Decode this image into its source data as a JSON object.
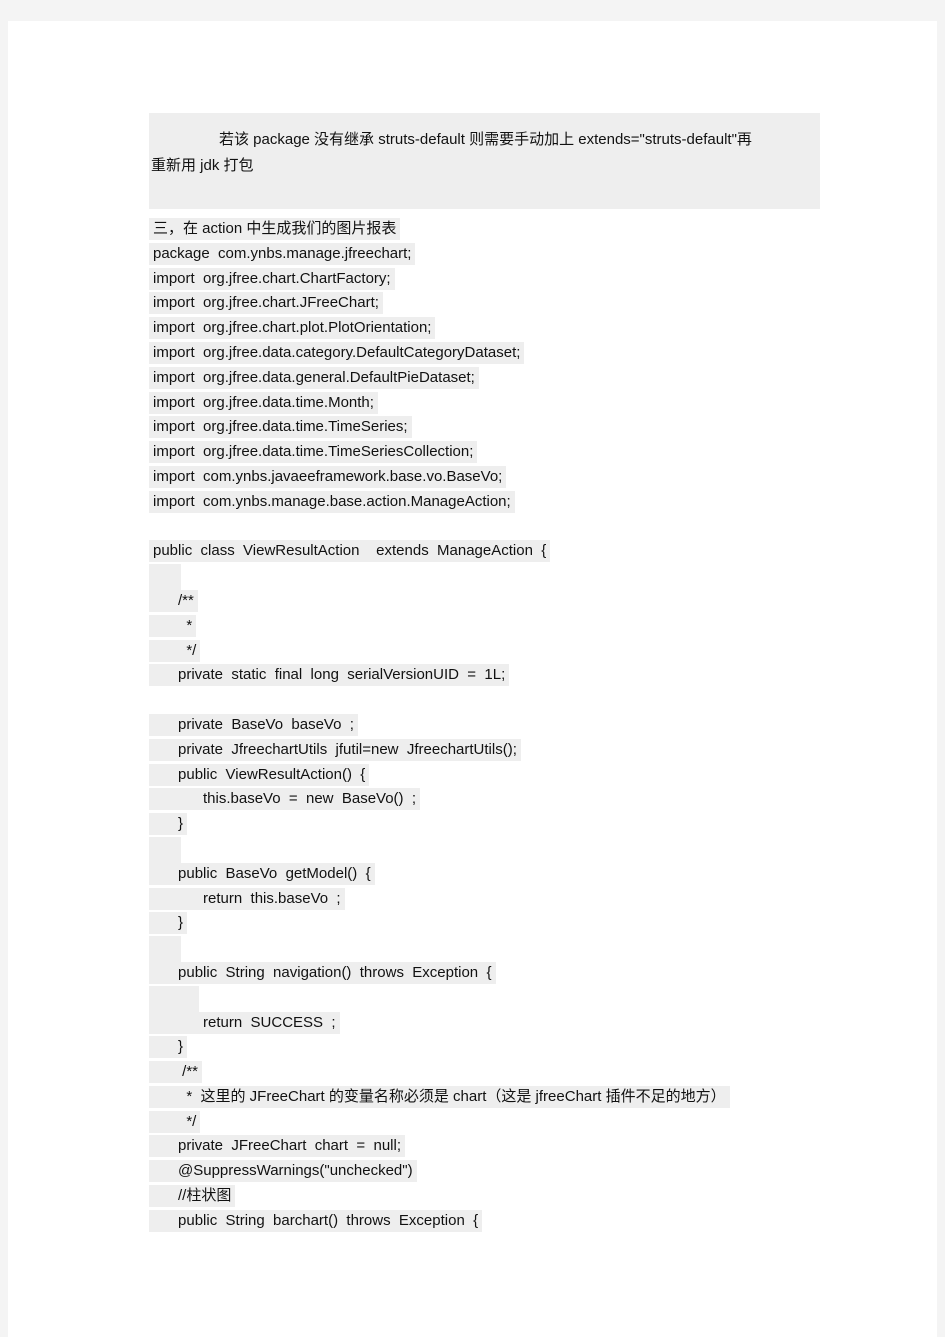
{
  "document": {
    "callout": {
      "lines": [
        "若该 package 没有继承 struts-default 则需要手动加上 extends=\"struts-default\"再",
        "重新用 jdk 打包"
      ]
    },
    "section_heading": "三，在 action 中生成我们的图片报表",
    "code_lines": [
      "package  com.ynbs.manage.jfreechart;",
      "import  org.jfree.chart.ChartFactory;",
      "import  org.jfree.chart.JFreeChart;",
      "import  org.jfree.chart.plot.PlotOrientation;",
      "import  org.jfree.data.category.DefaultCategoryDataset;",
      "import  org.jfree.data.general.DefaultPieDataset;",
      "import  org.jfree.data.time.Month;",
      "import  org.jfree.data.time.TimeSeries;",
      "import  org.jfree.data.time.TimeSeriesCollection;",
      "import  com.ynbs.javaeeframework.base.vo.BaseVo;",
      "import  com.ynbs.manage.base.action.ManageAction;",
      "",
      "public  class  ViewResultAction    extends  ManageAction  {",
      "    ",
      "      /**",
      "        *",
      "        */",
      "      private  static  final  long  serialVersionUID  =  1L;",
      "",
      "      private  BaseVo  baseVo  ;",
      "      private  JfreechartUtils  jfutil=new  JfreechartUtils();",
      "      public  ViewResultAction()  {",
      "            this.baseVo  =  new  BaseVo()  ;",
      "      }",
      "    ",
      "      public  BaseVo  getModel()  {",
      "            return  this.baseVo  ;",
      "      }",
      "    ",
      "      public  String  navigation()  throws  Exception  {",
      "          ",
      "            return  SUCCESS  ;",
      "      }",
      "       /**",
      "        *  这里的 JFreeChart 的变量名称必须是 chart（这是 jfreeChart 插件不足的地方）",
      "        */",
      "      private  JFreeChart  chart  =  null;",
      "      @SuppressWarnings(\"unchecked\")",
      "      //柱状图",
      "      public  String  barchart()  throws  Exception  {"
    ]
  }
}
